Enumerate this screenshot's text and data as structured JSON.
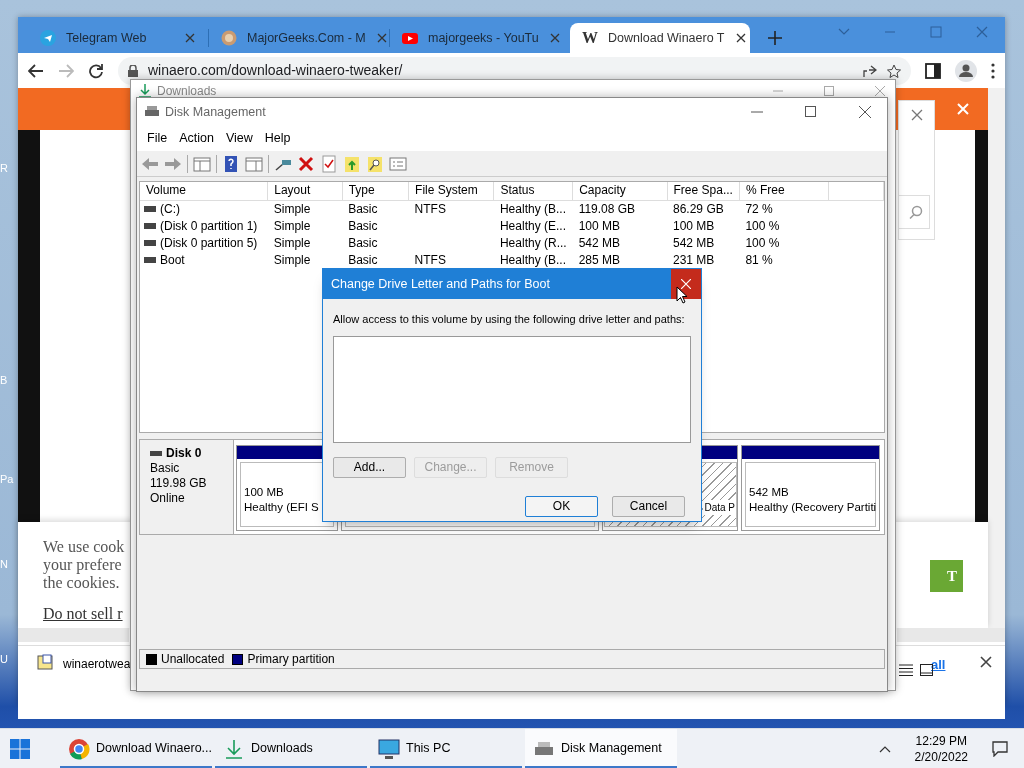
{
  "desktop": {
    "icon_labels": [
      "R",
      "B",
      "Pa",
      "N",
      "U"
    ]
  },
  "browser": {
    "tabs": [
      {
        "title": "Telegram Web",
        "kind": "telegram",
        "selected": false
      },
      {
        "title": "MajorGeeks.Com - M",
        "kind": "avatar",
        "selected": false
      },
      {
        "title": "majorgeeks - YouTu",
        "kind": "video",
        "selected": false
      },
      {
        "title": "Download Winaero T",
        "kind": "letter",
        "icon_text": "W",
        "selected": true
      }
    ],
    "address": "winaero.com/download-winaero-tweaker/",
    "cookie_lines": [
      "We use cook",
      "your prefere",
      "the cookies."
    ],
    "cookie_link": "Do not sell r",
    "accept_button": "T",
    "download_file": "winaerotwea",
    "download_link": "all"
  },
  "downloads_window": {
    "title": "Downloads"
  },
  "disk_management": {
    "title": "Disk Management",
    "menu": [
      "File",
      "Action",
      "View",
      "Help"
    ],
    "columns": [
      "Volume",
      "Layout",
      "Type",
      "File System",
      "Status",
      "Capacity",
      "Free Spa...",
      "% Free"
    ],
    "rows": [
      [
        "(C:)",
        "Simple",
        "Basic",
        "NTFS",
        "Healthy (B...",
        "119.08 GB",
        "86.29 GB",
        "72 %"
      ],
      [
        "(Disk 0 partition 1)",
        "Simple",
        "Basic",
        "",
        "Healthy (E...",
        "100 MB",
        "100 MB",
        "100 %"
      ],
      [
        "(Disk 0 partition 5)",
        "Simple",
        "Basic",
        "",
        "Healthy (R...",
        "542 MB",
        "542 MB",
        "100 %"
      ],
      [
        "Boot",
        "Simple",
        "Basic",
        "NTFS",
        "Healthy (B...",
        "285 MB",
        "231 MB",
        "81 %"
      ]
    ],
    "disk": {
      "name": "Disk 0",
      "type": "Basic",
      "size": "119.98 GB",
      "status": "Online"
    },
    "partitions": [
      {
        "size": "100 MB",
        "status": "Healthy (EFI S",
        "selected": false
      },
      {
        "selected": false
      },
      {
        "status": "Data P",
        "selected": true
      },
      {
        "size": "542 MB",
        "status": "Healthy (Recovery Partiti",
        "selected": false
      }
    ],
    "legend": [
      {
        "label": "Unallocated",
        "color": "#000000"
      },
      {
        "label": "Primary partition",
        "color": "#000080"
      }
    ]
  },
  "dialog": {
    "title": "Change Drive Letter and Paths for Boot",
    "prompt": "Allow access to this volume by using the following drive letter and paths:",
    "buttons": [
      {
        "label": "Add...",
        "disabled": false
      },
      {
        "label": "Change...",
        "disabled": true
      },
      {
        "label": "Remove",
        "disabled": true
      }
    ],
    "footer_buttons": [
      {
        "label": "OK",
        "default": true
      },
      {
        "label": "Cancel",
        "default": false
      }
    ]
  },
  "taskbar": {
    "items": [
      {
        "label": "Download Winaero...",
        "kind": "chrome",
        "selected": false
      },
      {
        "label": "Downloads",
        "kind": "download",
        "selected": false
      },
      {
        "label": "This PC",
        "kind": "monitor",
        "selected": false
      },
      {
        "label": "Disk Management",
        "kind": "disk",
        "selected": true
      }
    ],
    "time": "12:29 PM",
    "date": "2/20/2022"
  }
}
